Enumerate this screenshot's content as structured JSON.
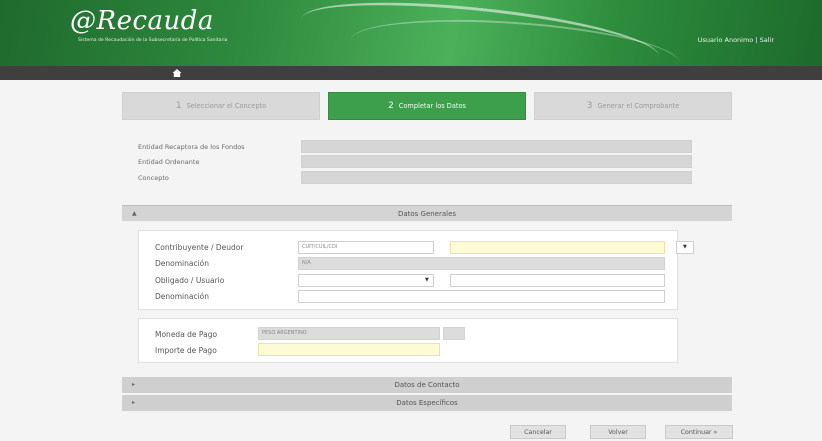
{
  "header": {
    "logo": "@Recauda",
    "subtitle": "Sistema de Recaudación de la Subsecretaría de Política Sanitaria",
    "user_links": "Usuario Anonimo | Salir"
  },
  "nav": {
    "home_icon": "home-icon"
  },
  "wizard": {
    "steps": [
      {
        "num": "1",
        "label": "Seleccionar el Concepto"
      },
      {
        "num": "2",
        "label": "Completar los Datos"
      },
      {
        "num": "3",
        "label": "Generar el Comprobante"
      }
    ]
  },
  "info": {
    "entidad_recaudadora": "Entidad Recaptora de los Fondos",
    "entidad_ordenante": "Entidad Ordenante",
    "concepto": "Concepto"
  },
  "datos_generales": {
    "title": "Datos Generales",
    "contribuyente_label": "Contribuyente / Deudor",
    "contribuyente_value": "CUIT/CUIL/CDI",
    "denominacion_label": "Denominación",
    "denominacion_value": "N/A",
    "obligado_label": "Obligado / Usuario",
    "denominacion2_label": "Denominación",
    "moneda_label": "Moneda de Pago",
    "moneda_value": "PESO ARGENTINO",
    "importe_label": "Importe de Pago"
  },
  "sections": {
    "contacto": "Datos de Contacto",
    "especificos": "Datos Específicos"
  },
  "buttons": {
    "cancelar": "Cancelar",
    "volver": "Volver",
    "continuar": "Continuar »"
  }
}
